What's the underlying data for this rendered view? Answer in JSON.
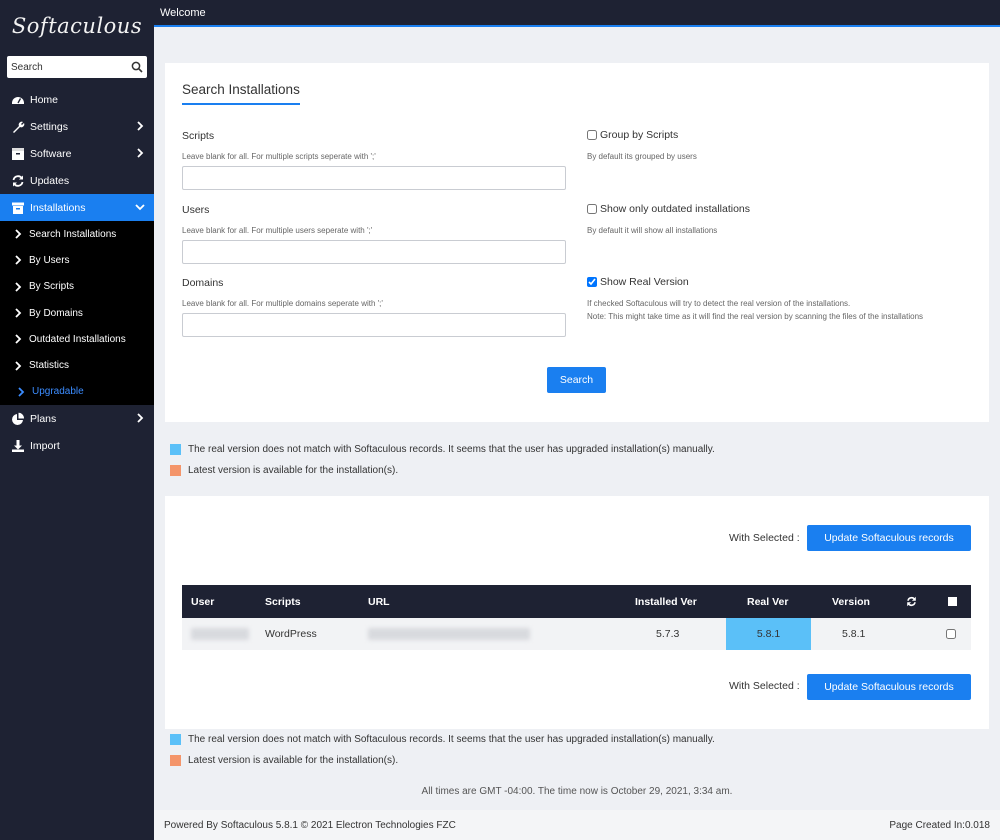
{
  "brand": {
    "logo_text": "Softaculous"
  },
  "topbar": {
    "title": "Welcome"
  },
  "sidebar": {
    "search_placeholder": "Search",
    "items": [
      {
        "label": "Home"
      },
      {
        "label": "Settings"
      },
      {
        "label": "Software"
      },
      {
        "label": "Updates"
      },
      {
        "label": "Installations"
      },
      {
        "label": "Plans"
      },
      {
        "label": "Import"
      }
    ],
    "subitems": [
      {
        "label": "Search Installations"
      },
      {
        "label": "By Users"
      },
      {
        "label": "By Scripts"
      },
      {
        "label": "By Domains"
      },
      {
        "label": "Outdated Installations"
      },
      {
        "label": "Statistics"
      },
      {
        "label": "Upgradable"
      }
    ]
  },
  "search_panel": {
    "title": "Search Installations",
    "scripts": {
      "label": "Scripts",
      "hint": "Leave blank for all. For multiple scripts seperate with ';'",
      "value": ""
    },
    "users": {
      "label": "Users",
      "hint": "Leave blank for all. For multiple users seperate with ';'",
      "value": ""
    },
    "domains": {
      "label": "Domains",
      "hint": "Leave blank for all. For multiple domains seperate with ';'",
      "value": ""
    },
    "group_by_scripts": {
      "label": "Group by Scripts",
      "hint": "By default its grouped by users",
      "checked": false
    },
    "outdated_only": {
      "label": "Show only outdated installations",
      "hint": "By default it will show all installations",
      "checked": false
    },
    "real_version": {
      "label": "Show Real Version",
      "hint1": "If checked Softaculous will try to detect the real version of the installations.",
      "hint2": "Note: This might take time as it will find the real version by scanning the files of the installations",
      "checked": true
    },
    "search_button": "Search"
  },
  "legend": {
    "blue_text": "The real version does not match with Softaculous records. It seems that the user has upgraded installation(s) manually.",
    "orange_text": "Latest version is available for the installation(s).",
    "blue_color": "#5bc0f8",
    "orange_color": "#f4956a"
  },
  "results": {
    "with_selected": "With Selected :",
    "update_button": "Update Softaculous records",
    "columns": [
      "User",
      "Scripts",
      "URL",
      "Installed Ver",
      "Real Ver",
      "Version"
    ],
    "rows": [
      {
        "script": "WordPress",
        "installed_ver": "5.7.3",
        "real_ver": "5.8.1",
        "version": "5.8.1",
        "selected": false
      }
    ]
  },
  "footer": {
    "times_note": "All times are GMT -04:00. The time now is October 29, 2021, 3:34 am.",
    "powered": "Powered By Softaculous 5.8.1 © 2021 Electron Technologies FZC",
    "page_created": "Page Created In:0.018"
  },
  "colors": {
    "accent": "#1a7ff0",
    "dark": "#1e2233"
  }
}
